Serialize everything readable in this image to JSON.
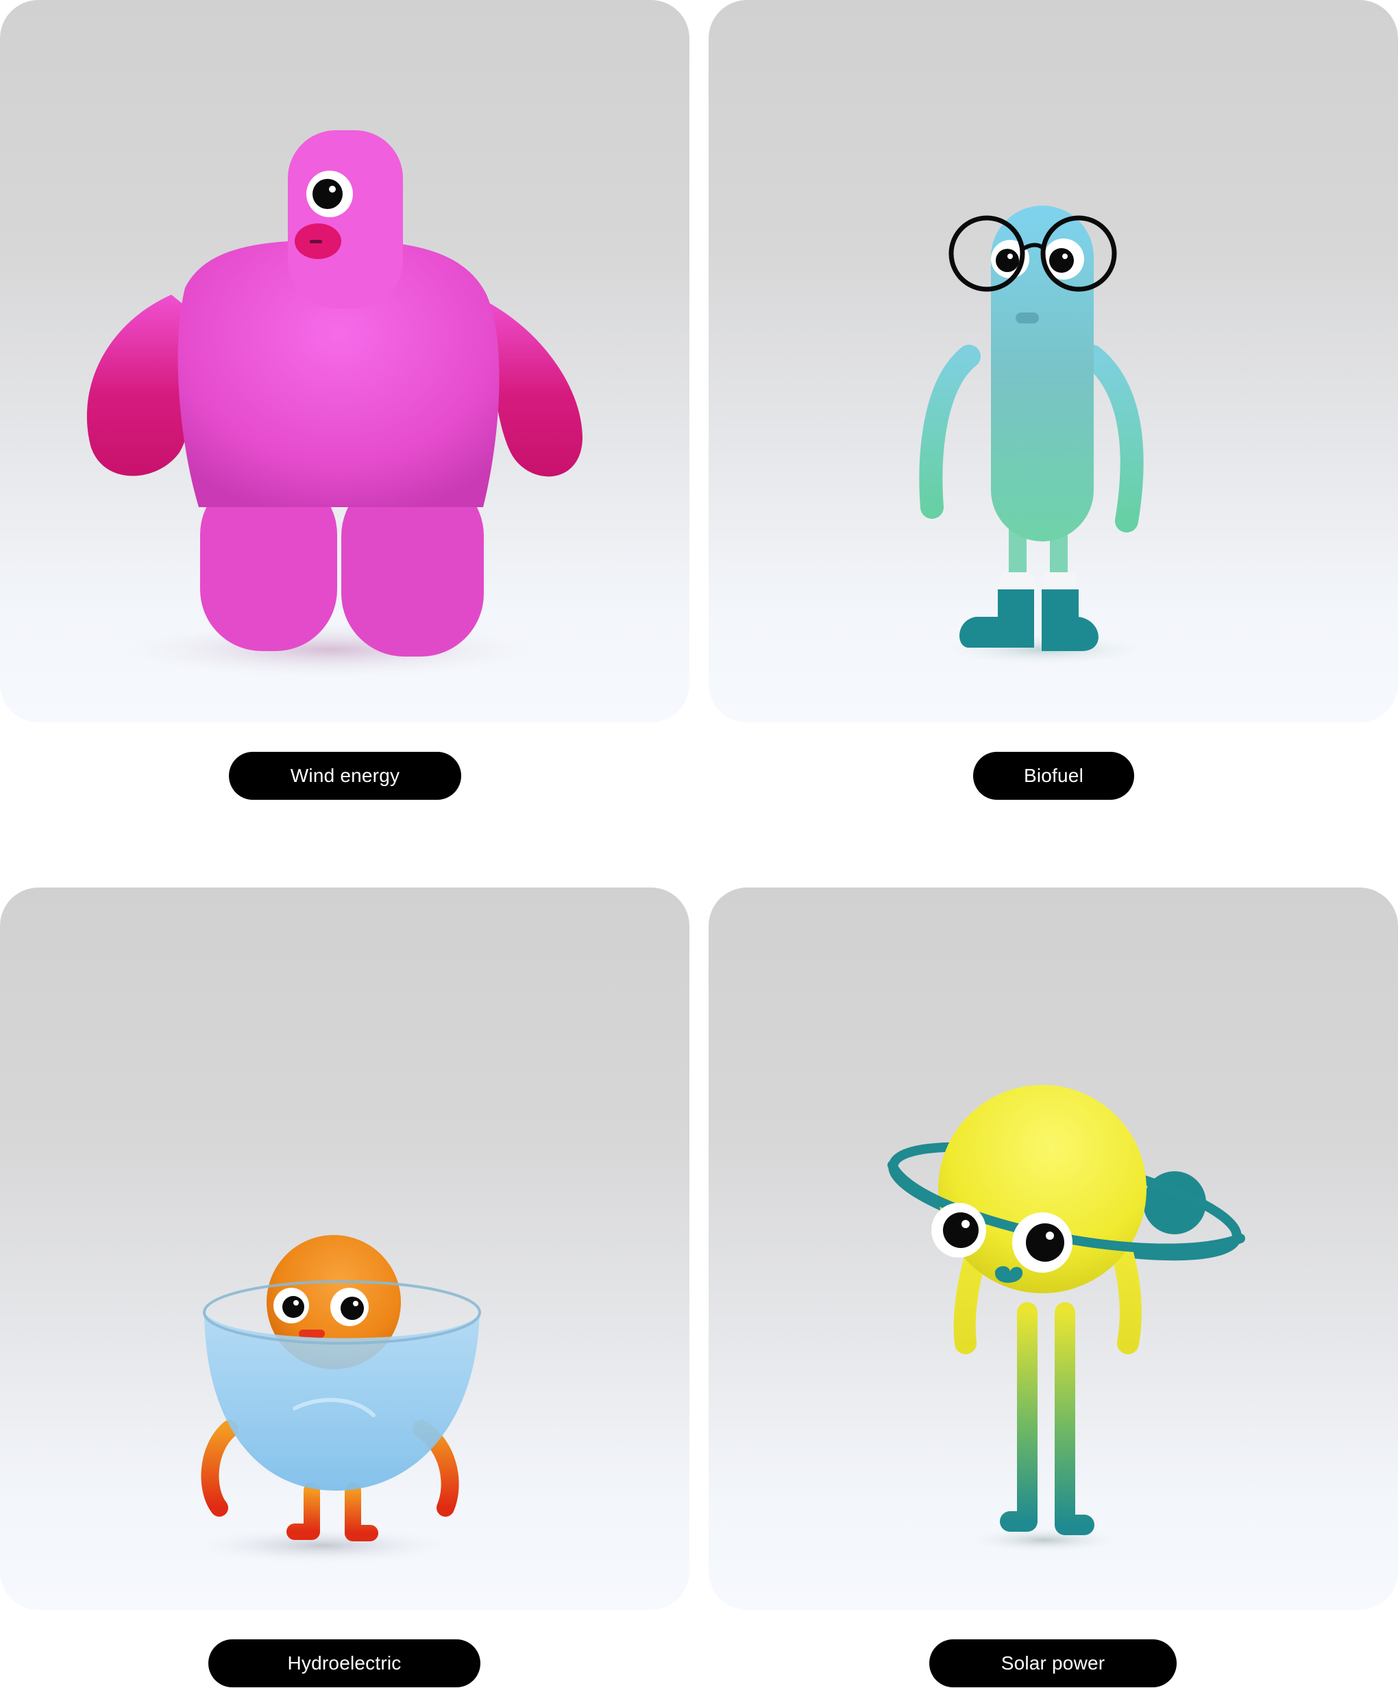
{
  "cards": [
    {
      "label": "Wind energy",
      "character": "pink-cyclops-character",
      "colors": {
        "body": "#e64fcf",
        "accent": "#d4146f"
      }
    },
    {
      "label": "Biofuel",
      "character": "teal-glasses-character",
      "colors": {
        "body": "#7fd3c4",
        "accent": "#1f8a92"
      }
    },
    {
      "label": "Hydroelectric",
      "character": "orange-bowl-character",
      "colors": {
        "body": "#f08a1c",
        "accent": "#8fc7ef"
      }
    },
    {
      "label": "Solar power",
      "character": "yellow-ringed-planet-character",
      "colors": {
        "body": "#f2ec3a",
        "accent": "#1f8a92"
      }
    }
  ],
  "theme": {
    "label_background": "#000000",
    "label_text": "#ffffff"
  }
}
